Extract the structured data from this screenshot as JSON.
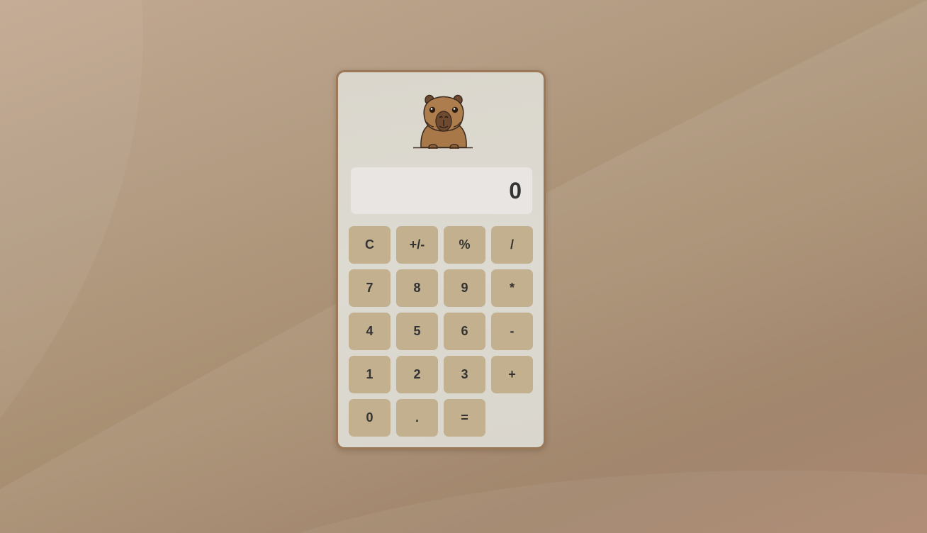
{
  "display": {
    "value": "0"
  },
  "mascot": {
    "icon": "capybara-icon"
  },
  "keys": [
    {
      "label": "C",
      "name": "clear-button"
    },
    {
      "label": "+/-",
      "name": "sign-toggle-button"
    },
    {
      "label": "%",
      "name": "percent-button"
    },
    {
      "label": "/",
      "name": "divide-button"
    },
    {
      "label": "7",
      "name": "digit-7-button"
    },
    {
      "label": "8",
      "name": "digit-8-button"
    },
    {
      "label": "9",
      "name": "digit-9-button"
    },
    {
      "label": "*",
      "name": "multiply-button"
    },
    {
      "label": "4",
      "name": "digit-4-button"
    },
    {
      "label": "5",
      "name": "digit-5-button"
    },
    {
      "label": "6",
      "name": "digit-6-button"
    },
    {
      "label": "-",
      "name": "subtract-button"
    },
    {
      "label": "1",
      "name": "digit-1-button"
    },
    {
      "label": "2",
      "name": "digit-2-button"
    },
    {
      "label": "3",
      "name": "digit-3-button"
    },
    {
      "label": "+",
      "name": "add-button"
    },
    {
      "label": "0",
      "name": "digit-0-button"
    },
    {
      "label": ".",
      "name": "decimal-button"
    },
    {
      "label": "=",
      "name": "equals-button"
    }
  ],
  "colors": {
    "key": "#c2b08f",
    "frame": "#9a7858",
    "panel": "#dad6cc",
    "display": "#e8e5e2",
    "text": "#333333"
  }
}
